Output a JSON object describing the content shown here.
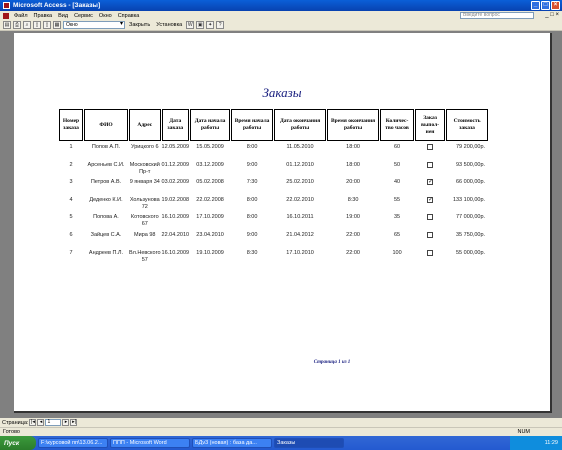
{
  "window": {
    "title": "Microsoft Access - [Заказы]"
  },
  "menu": {
    "items": [
      "Файл",
      "Правка",
      "Вид",
      "Сервис",
      "Окно",
      "Справка"
    ],
    "help_placeholder": "Введите вопрос"
  },
  "toolbar": {
    "zoom_value": "Окно",
    "close_label": "Закрыть",
    "setup_label": "Установка"
  },
  "report": {
    "title": "Заказы",
    "headers": [
      "Номер заказа",
      "ФИО",
      "Адрес",
      "Дата заказа",
      "Дата начала работы",
      "Время начала работы",
      "Дата окончания работы",
      "Время окончания работы",
      "Количес-тво часов",
      "Заказ выпол-нен",
      "Стоимость заказа"
    ],
    "rows": [
      {
        "num": "1",
        "fio": "Попов А.П.",
        "addr": "Урицкого 6",
        "order_date": "12.05.2009",
        "start_date": "15.05.2009",
        "start_time": "8:00",
        "end_date": "11.05.2010",
        "end_time": "18:00",
        "hours": "60",
        "done": false,
        "cost": "79 200,00р."
      },
      {
        "num": "2",
        "fio": "Арсеньев С.И.",
        "addr": "Московский Пр-т",
        "order_date": "01.12.2009",
        "start_date": "03.12.2009",
        "start_time": "9:00",
        "end_date": "01.12.2010",
        "end_time": "18:00",
        "hours": "50",
        "done": false,
        "cost": "93 500,00р."
      },
      {
        "num": "3",
        "fio": "Петров А.В.",
        "addr": "9 января 34",
        "order_date": "03.02.2009",
        "start_date": "05.02.2008",
        "start_time": "7:30",
        "end_date": "25.02.2010",
        "end_time": "20:00",
        "hours": "40",
        "done": true,
        "cost": "66 000,00р."
      },
      {
        "num": "4",
        "fio": "Деденко К.И.",
        "addr": "Хользунова 72",
        "order_date": "19.02.2008",
        "start_date": "22.02.2008",
        "start_time": "8:00",
        "end_date": "22.02.2010",
        "end_time": "8:30",
        "hours": "55",
        "done": true,
        "cost": "133 100,00р."
      },
      {
        "num": "5",
        "fio": "Попова А.",
        "addr": "Котовского 67",
        "order_date": "16.10.2009",
        "start_date": "17.10.2009",
        "start_time": "8:00",
        "end_date": "16.10.2011",
        "end_time": "19:00",
        "hours": "35",
        "done": false,
        "cost": "77 000,00р."
      },
      {
        "num": "6",
        "fio": "Зайцев С.А.",
        "addr": "Мира 98",
        "order_date": "22.04.2010",
        "start_date": "23.04.2010",
        "start_time": "9:00",
        "end_date": "21.04.2012",
        "end_time": "22:00",
        "hours": "65",
        "done": false,
        "cost": "35 750,00р."
      },
      {
        "num": "7",
        "fio": "Андреев П.Л.",
        "addr": "Вл.Невского 57",
        "order_date": "16.10.2009",
        "start_date": "19.10.2009",
        "start_time": "8:30",
        "end_date": "17.10.2010",
        "end_time": "22:00",
        "hours": "100",
        "done": false,
        "cost": "55 000,00р."
      }
    ],
    "footer": "Страница 1 из 1"
  },
  "navigation": {
    "label": "Страница:",
    "page": "1"
  },
  "status": {
    "left": "Готово",
    "right": "NUM"
  },
  "taskbar": {
    "start": "Пуск",
    "tasks": [
      "F:\\курсовой пп\\13.06.2...",
      "ППП - Microsoft Word",
      "БДv3 (новая) : база да...",
      "Заказы"
    ],
    "clock": "11:29"
  }
}
